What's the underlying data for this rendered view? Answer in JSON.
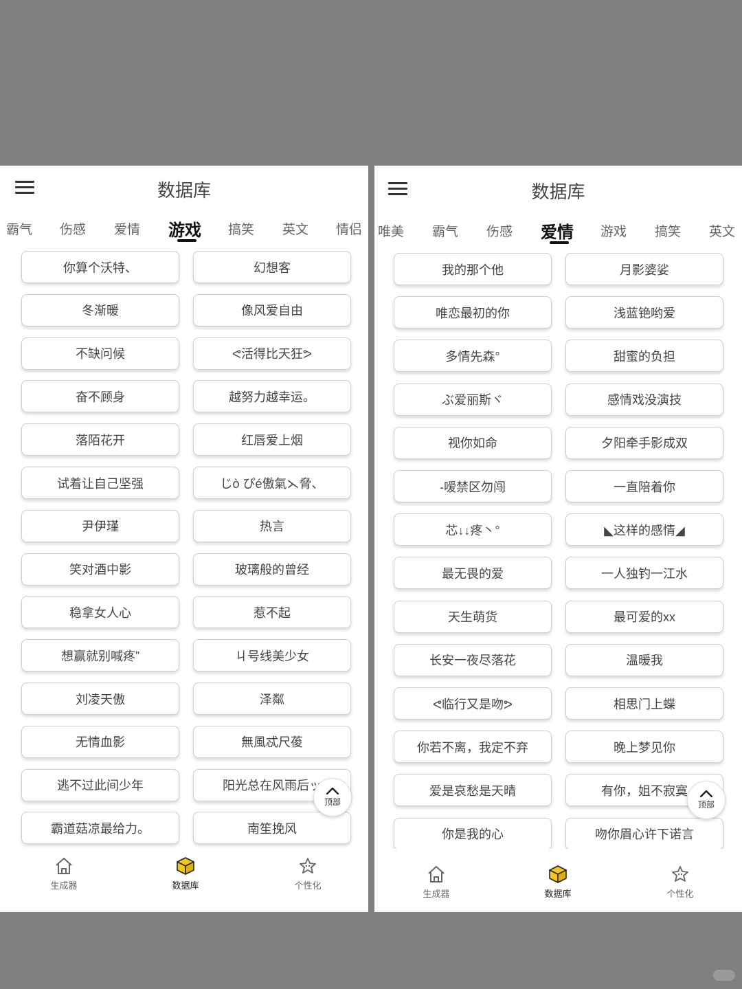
{
  "left": {
    "title": "数据库",
    "tabs": [
      "霸气",
      "伤感",
      "爱情",
      "游戏",
      "搞笑",
      "英文",
      "情侣"
    ],
    "active_tab": "游戏",
    "items": [
      "你算个沃特、",
      "幻想客",
      "冬渐暖",
      "像风爱自由",
      "不缺问候",
      "ᕙ活得比天狂ᕗ",
      "奋不顾身",
      "越努力越幸运。",
      "落陌花开",
      "红唇爱上烟",
      "试着让自己坚强",
      "じò ぴé傲氣⋋脅、",
      "尹伊瑾",
      "热言",
      "笑对酒中影",
      "玻璃般的曾经",
      "稳拿女人心",
      "惹不起",
      "想赢就别喊疼”",
      "ㄐ号线美少女",
      "刘凌天傲",
      "泽粼",
      "无情血影",
      "無風忒尺葰",
      "逃不过此间少年",
      "阳光总在风雨后ッ",
      "霸道菇凉最给力。",
      "南笙挽风"
    ],
    "back_to_top": "顶部",
    "nav": [
      "生成器",
      "数据库",
      "个性化"
    ]
  },
  "right": {
    "title": "数据库",
    "tabs": [
      "唯美",
      "霸气",
      "伤感",
      "爱情",
      "游戏",
      "搞笑",
      "英文"
    ],
    "active_tab": "爱情",
    "items": [
      "我的那个他",
      "月影婆娑",
      "唯恋最初的你",
      "浅蓝铯哟爱",
      "多情先森°",
      "甜蜜的负担",
      "ぶ爱丽斯ヾ",
      "感情戏没演技",
      "视你如命",
      "夕阳牵手影成双",
      "-嗳禁区勿闯",
      "一直陪着你",
      "芯↓↓疼丶°",
      "◣这样的感情◢",
      "最无畏的爱",
      "一人独钓一江水",
      "天生萌货",
      "最可爱的xx",
      "长安一夜尽落花",
      "温暖我",
      "ᕙ临行又是吻ᕗ",
      "相思门上蝶",
      "你若不离，我定不弃",
      "晚上梦见你",
      "爱是哀愁是天晴",
      "有你，姐不寂寞",
      "你是我的心",
      "吻你眉心许下诺言"
    ],
    "back_to_top": "顶部",
    "nav": [
      "生成器",
      "数据库",
      "个性化"
    ]
  },
  "colors": {
    "accent": "#F5C518",
    "text": "#444444",
    "background": "#808080"
  },
  "icons": {
    "menu": "hamburger-icon",
    "top": "chevron-up-icon",
    "nav": [
      "home-icon",
      "cube-icon",
      "star-sparkle-icon"
    ]
  }
}
